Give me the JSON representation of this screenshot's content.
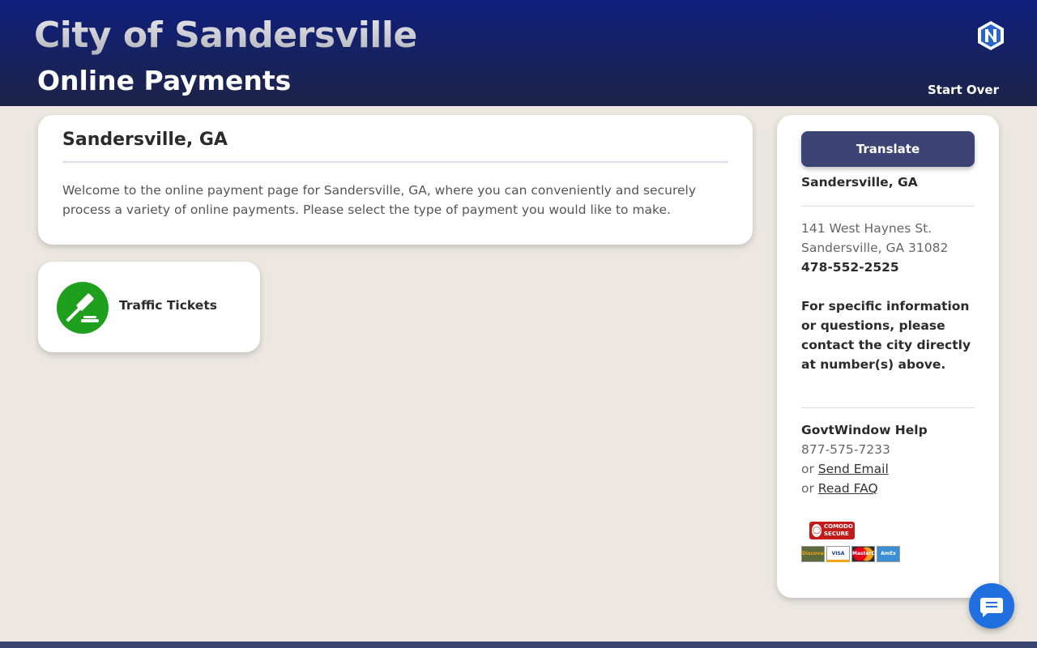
{
  "header": {
    "city_title": "City of Sandersville",
    "page_title": "Online Payments",
    "start_over": "Start Over"
  },
  "welcome": {
    "heading": "Sandersville, GA",
    "body": "Welcome to the online payment page for Sandersville, GA, where you can conveniently and securely process a variety of online payments. Please select the type of payment you would like to make."
  },
  "payment_types": [
    {
      "label": "Traffic Tickets",
      "icon": "gavel-icon",
      "color": "#1ea01e"
    }
  ],
  "sidebar": {
    "translate_label": "Translate",
    "city_name": "Sandersville, GA",
    "address_line1": "141 West Haynes St.",
    "address_line2": "Sandersville, GA 31082",
    "phone": "478-552-2525",
    "contact_note": "For specific information or questions, please contact the city directly at number(s) above.",
    "help_title": "GovtWindow Help",
    "help_phone": "877-575-7233",
    "or_text": "or",
    "send_email": "Send Email",
    "read_faq": "Read FAQ"
  },
  "badges": {
    "comodo_line1": "COMODO",
    "comodo_line2": "SECURE",
    "card_brands": [
      "Discover",
      "VISA",
      "MasterCard",
      "AmEx"
    ]
  },
  "colors": {
    "header_top": "#101f7e",
    "header_bottom": "#1d2448",
    "button": "#3d4475",
    "accent_green": "#1ea01e",
    "chat_blue": "#1f6fe0"
  }
}
